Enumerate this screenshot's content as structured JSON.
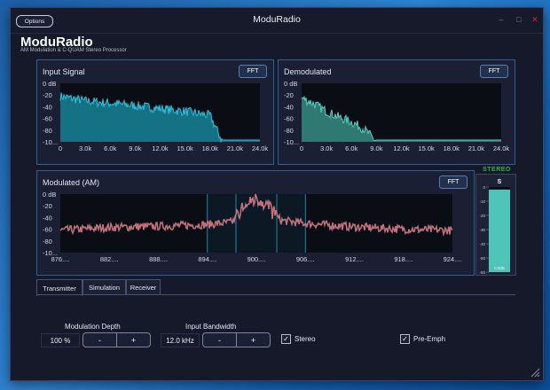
{
  "window": {
    "title": "ModuRadio",
    "options_label": "Options",
    "controls": {
      "minimize": "–",
      "maximize": "□",
      "close": "✕"
    }
  },
  "app": {
    "title": "ModuRadio",
    "subtitle": "AM Modulation & C-QUAM Stereo Processor"
  },
  "charts": {
    "input": {
      "title": "Input Signal",
      "fft_label": "FFT",
      "y_ticks": [
        "0 dB",
        "-20",
        "-40",
        "-60",
        "-80",
        "-10..."
      ],
      "x_ticks": [
        "0",
        "3.0k",
        "6.0k",
        "9.0k",
        "12.0k",
        "15.0k",
        "18.0k",
        "21.0k",
        "24.0k"
      ]
    },
    "demod": {
      "title": "Demodulated",
      "fft_label": "FFT",
      "y_ticks": [
        "0 dB",
        "-20",
        "-40",
        "-60",
        "-80",
        "-10..."
      ],
      "x_ticks": [
        "0",
        "3.0k",
        "6.0k",
        "9.0k",
        "12.0k",
        "15.0k",
        "18.0k",
        "21.0k",
        "24.0k"
      ]
    },
    "modulated": {
      "title": "Modulated (AM)",
      "fft_label": "FFT",
      "y_ticks": [
        "0 dB",
        "-20",
        "-40",
        "-60",
        "-80",
        "-10..."
      ],
      "x_ticks": [
        "876....",
        "882....",
        "888....",
        "894....",
        "900....",
        "906....",
        "912....",
        "918....",
        "924...."
      ]
    }
  },
  "chart_data": [
    {
      "type": "area",
      "title": "Input Signal",
      "x": [
        0,
        3000,
        6000,
        9000,
        12000,
        15000,
        18000,
        19500,
        21000,
        24000
      ],
      "y": [
        -22,
        -30,
        -34,
        -38,
        -43,
        -48,
        -55,
        -100,
        -100,
        -100
      ],
      "xlim": [
        0,
        24000
      ],
      "ylim": [
        -100,
        0
      ],
      "color": "#1fc6e0"
    },
    {
      "type": "area",
      "title": "Demodulated",
      "x": [
        0,
        1500,
        3000,
        4500,
        6000,
        7500,
        9000,
        12000,
        24000
      ],
      "y": [
        -25,
        -35,
        -48,
        -58,
        -66,
        -78,
        -100,
        -100,
        -100
      ],
      "xlim": [
        0,
        24000
      ],
      "ylim": [
        -100,
        0
      ],
      "color": "#4fd3c0"
    },
    {
      "type": "line",
      "title": "Modulated (AM)",
      "x": [
        876000,
        882000,
        888000,
        894000,
        897000,
        900000,
        903000,
        906000,
        912000,
        918000,
        924000
      ],
      "y": [
        -62,
        -57,
        -55,
        -52,
        -48,
        -8,
        -45,
        -50,
        -56,
        -60,
        -62
      ],
      "xlim": [
        876000,
        924000
      ],
      "ylim": [
        -100,
        0
      ],
      "color": "#e8666d"
    }
  ],
  "vu": {
    "label": "STEREO",
    "channel": "S",
    "ticks": [
      "0",
      "-10",
      "-20",
      "-30",
      "-40",
      "-50",
      "-60"
    ],
    "readout": "0.0dB",
    "level": 0.97
  },
  "tabs": [
    {
      "label": "Transmitter",
      "active": true
    },
    {
      "label": "Simulation",
      "active": false
    },
    {
      "label": "Receiver",
      "active": false
    }
  ],
  "transmitter": {
    "mod_depth": {
      "label": "Modulation Depth",
      "value": "100 %",
      "minus": "-",
      "plus": "+"
    },
    "bandwidth": {
      "label": "Input Bandwidth",
      "value": "12.0 kHz",
      "minus": "-",
      "plus": "+"
    },
    "stereo": {
      "label": "Stereo",
      "checked": true,
      "mark": "✓"
    },
    "pre_emph": {
      "label": "Pre-Emph",
      "checked": true,
      "mark": "✓"
    }
  }
}
